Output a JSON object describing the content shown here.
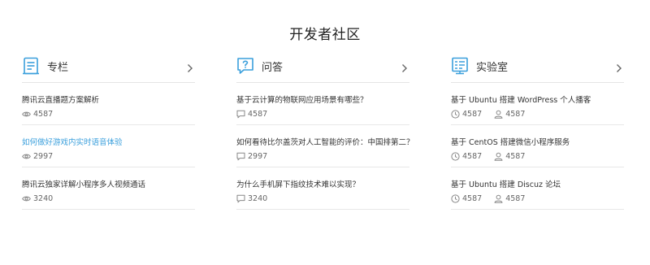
{
  "page": {
    "title": "开发者社区"
  },
  "columns": [
    {
      "title": "专栏",
      "icon": "article-icon",
      "items": [
        {
          "title": "腾讯云直播题方案解析",
          "views": "4587"
        },
        {
          "title": "如何做好游戏内实时语音体验",
          "views": "2997"
        },
        {
          "title": "腾讯云独家详解小程序多人视频通话",
          "views": "3240"
        }
      ]
    },
    {
      "title": "问答",
      "icon": "question-icon",
      "items": [
        {
          "title": "基于云计算的物联网应用场景有哪些？",
          "answers": "4587"
        },
        {
          "title": "如何看待比尔盖茨对人工智能的评价：中国排第二？",
          "answers": "2997"
        },
        {
          "title": "为什么手机屏下指纹技术难以实现？",
          "answers": "3240"
        }
      ]
    },
    {
      "title": "实验室",
      "icon": "lab-icon",
      "items": [
        {
          "title": "基于 Ubuntu 搭建 WordPress 个人播客",
          "time": "4587",
          "users": "4587"
        },
        {
          "title": "基于 CentOS 搭建微信小程序服务",
          "time": "4587",
          "users": "4587"
        },
        {
          "title": "基于 Ubuntu 搭建 Discuz 论坛",
          "time": "4587",
          "users": "4587"
        }
      ]
    }
  ],
  "colors": {
    "accent": "#3a9fdc",
    "text": "#333333",
    "meta": "#666666",
    "divider": "#e5e5e5"
  }
}
